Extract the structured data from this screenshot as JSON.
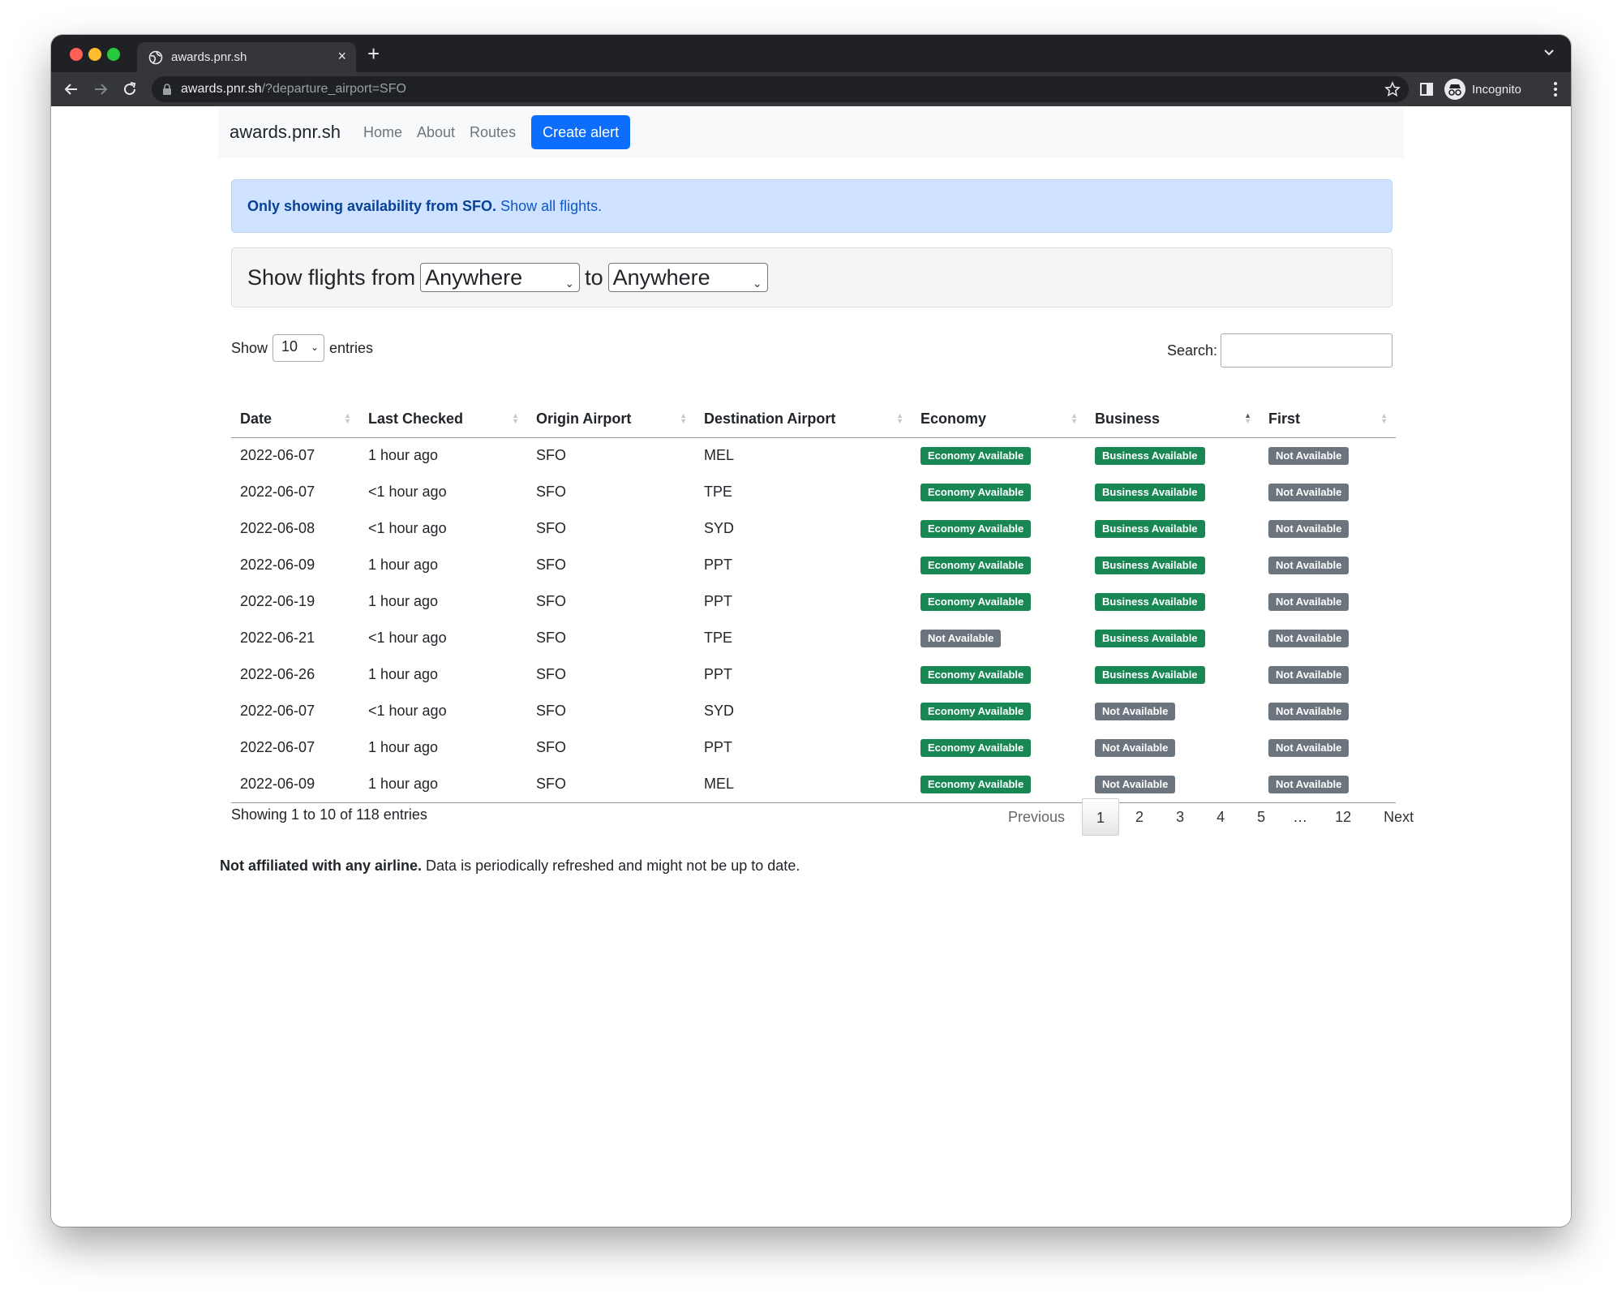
{
  "browser": {
    "tab_title": "awards.pnr.sh",
    "url_host": "awards.pnr.sh",
    "url_path": "/?departure_airport=SFO",
    "profile_label": "Incognito"
  },
  "nav": {
    "brand": "awards.pnr.sh",
    "links": [
      "Home",
      "About",
      "Routes"
    ],
    "cta": "Create alert"
  },
  "alert": {
    "bold_text": "Only showing availability from SFO.",
    "link_text": "Show all flights."
  },
  "filter": {
    "prefix": "Show flights from",
    "from_value": "Anywhere",
    "joiner": "to",
    "to_value": "Anywhere"
  },
  "datatable": {
    "show_label": "Show",
    "length_value": "10",
    "entries_label": "entries",
    "search_label": "Search:",
    "search_value": "",
    "columns": [
      "Date",
      "Last Checked",
      "Origin Airport",
      "Destination Airport",
      "Economy",
      "Business",
      "First"
    ],
    "rows": [
      {
        "date": "2022-06-07",
        "checked": "1 hour ago",
        "origin": "SFO",
        "dest": "MEL",
        "economy": "Economy Available",
        "business": "Business Available",
        "first": "Not Available"
      },
      {
        "date": "2022-06-07",
        "checked": "<1 hour ago",
        "origin": "SFO",
        "dest": "TPE",
        "economy": "Economy Available",
        "business": "Business Available",
        "first": "Not Available"
      },
      {
        "date": "2022-06-08",
        "checked": "<1 hour ago",
        "origin": "SFO",
        "dest": "SYD",
        "economy": "Economy Available",
        "business": "Business Available",
        "first": "Not Available"
      },
      {
        "date": "2022-06-09",
        "checked": "1 hour ago",
        "origin": "SFO",
        "dest": "PPT",
        "economy": "Economy Available",
        "business": "Business Available",
        "first": "Not Available"
      },
      {
        "date": "2022-06-19",
        "checked": "1 hour ago",
        "origin": "SFO",
        "dest": "PPT",
        "economy": "Economy Available",
        "business": "Business Available",
        "first": "Not Available"
      },
      {
        "date": "2022-06-21",
        "checked": "<1 hour ago",
        "origin": "SFO",
        "dest": "TPE",
        "economy": "Not Available",
        "business": "Business Available",
        "first": "Not Available"
      },
      {
        "date": "2022-06-26",
        "checked": "1 hour ago",
        "origin": "SFO",
        "dest": "PPT",
        "economy": "Economy Available",
        "business": "Business Available",
        "first": "Not Available"
      },
      {
        "date": "2022-06-07",
        "checked": "<1 hour ago",
        "origin": "SFO",
        "dest": "SYD",
        "economy": "Economy Available",
        "business": "Not Available",
        "first": "Not Available"
      },
      {
        "date": "2022-06-07",
        "checked": "1 hour ago",
        "origin": "SFO",
        "dest": "PPT",
        "economy": "Economy Available",
        "business": "Not Available",
        "first": "Not Available"
      },
      {
        "date": "2022-06-09",
        "checked": "1 hour ago",
        "origin": "SFO",
        "dest": "MEL",
        "economy": "Economy Available",
        "business": "Not Available",
        "first": "Not Available"
      }
    ],
    "info": "Showing 1 to 10 of 118 entries",
    "pagination": {
      "previous": "Previous",
      "pages": [
        "1",
        "2",
        "3",
        "4",
        "5",
        "…",
        "12"
      ],
      "current": "1",
      "next": "Next"
    }
  },
  "footer": {
    "bold_text": "Not affiliated with any airline.",
    "text": " Data is periodically refreshed and might not be up to date."
  },
  "colors": {
    "available": "#198754",
    "not_available": "#6c757d",
    "primary": "#0d6efd",
    "alert_bg": "#cfe2ff"
  }
}
